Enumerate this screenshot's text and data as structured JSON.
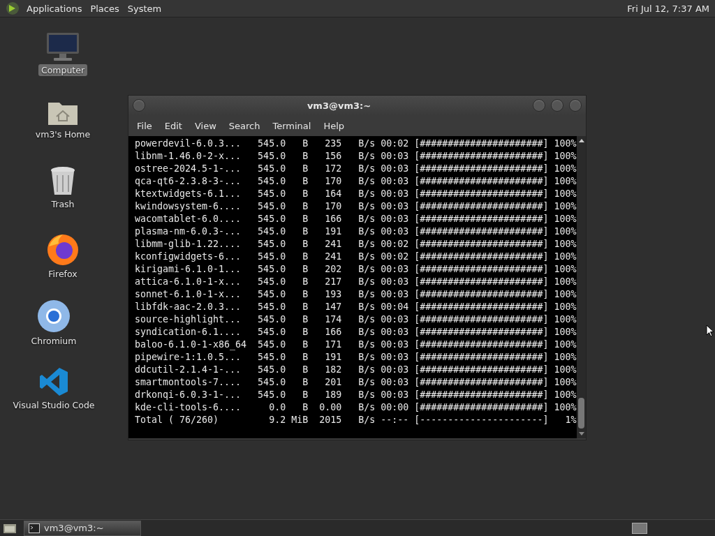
{
  "top_panel": {
    "menus": [
      "Applications",
      "Places",
      "System"
    ],
    "clock": "Fri Jul 12, 7:37 AM"
  },
  "desktop_icons": [
    {
      "kind": "computer",
      "label": "Computer",
      "selected": true
    },
    {
      "kind": "home",
      "label": "vm3's Home",
      "selected": false
    },
    {
      "kind": "trash",
      "label": "Trash",
      "selected": false
    },
    {
      "kind": "firefox",
      "label": "Firefox",
      "selected": false
    },
    {
      "kind": "chromium",
      "label": "Chromium",
      "selected": false
    },
    {
      "kind": "vscode",
      "label": "Visual Studio Code",
      "selected": false
    }
  ],
  "terminal_window": {
    "title": "vm3@vm3:~",
    "menu": [
      "File",
      "Edit",
      "View",
      "Search",
      "Terminal",
      "Help"
    ],
    "lines": [
      "powerdevil-6.0.3...   545.0   B   235   B/s 00:02 [######################] 100%",
      "libnm-1.46.0-2-x...   545.0   B   156   B/s 00:03 [######################] 100%",
      "ostree-2024.5-1-...   545.0   B   172   B/s 00:03 [######################] 100%",
      "qca-qt6-2.3.8-3-...   545.0   B   170   B/s 00:03 [######################] 100%",
      "ktextwidgets-6.1...   545.0   B   164   B/s 00:03 [######################] 100%",
      "kwindowsystem-6....   545.0   B   170   B/s 00:03 [######################] 100%",
      "wacomtablet-6.0....   545.0   B   166   B/s 00:03 [######################] 100%",
      "plasma-nm-6.0.3-...   545.0   B   191   B/s 00:03 [######################] 100%",
      "libmm-glib-1.22....   545.0   B   241   B/s 00:02 [######################] 100%",
      "kconfigwidgets-6...   545.0   B   241   B/s 00:02 [######################] 100%",
      "kirigami-6.1.0-1...   545.0   B   202   B/s 00:03 [######################] 100%",
      "attica-6.1.0-1-x...   545.0   B   217   B/s 00:03 [######################] 100%",
      "sonnet-6.1.0-1-x...   545.0   B   193   B/s 00:03 [######################] 100%",
      "libfdk-aac-2.0.3...   545.0   B   147   B/s 00:04 [######################] 100%",
      "source-highlight...   545.0   B   174   B/s 00:03 [######################] 100%",
      "syndication-6.1....   545.0   B   166   B/s 00:03 [######################] 100%",
      "baloo-6.1.0-1-x86_64  545.0   B   171   B/s 00:03 [######################] 100%",
      "pipewire-1:1.0.5...   545.0   B   191   B/s 00:03 [######################] 100%",
      "ddcutil-2.1.4-1-...   545.0   B   182   B/s 00:03 [######################] 100%",
      "smartmontools-7....   545.0   B   201   B/s 00:03 [######################] 100%",
      "drkonqi-6.0.3-1-...   545.0   B   189   B/s 00:03 [######################] 100%",
      "kde-cli-tools-6....     0.0   B  0.00   B/s 00:00 [######################] 100%",
      "Total ( 76/260)         9.2 MiB  2015   B/s --:-- [----------------------]   1%"
    ]
  },
  "taskbar": {
    "tasks": [
      {
        "label": "vm3@vm3:~",
        "selected": true
      }
    ]
  }
}
